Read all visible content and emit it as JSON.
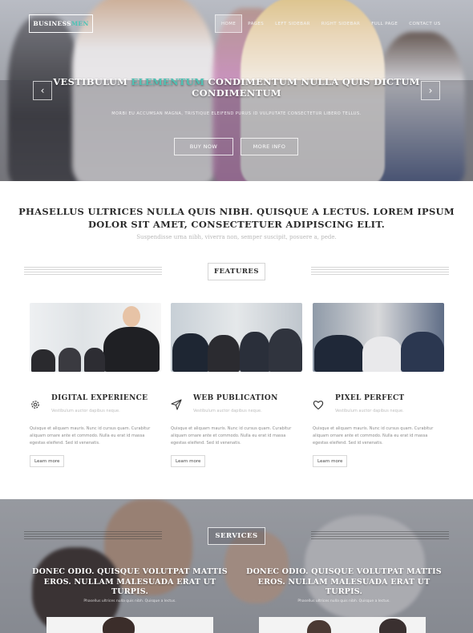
{
  "header": {
    "logo": {
      "text_main": "BUSINESS ",
      "text_accent": "MEN"
    },
    "nav": [
      "HOME",
      "PAGES",
      "LEFT SIDEBAR",
      "RIGHT SIDEBAR",
      "FULL PAGE",
      "CONTACT US"
    ],
    "active_nav": "HOME"
  },
  "hero": {
    "title_pre": "VESTIBULUM ",
    "title_accent": "ELEMENTUM",
    "title_post": " CONDIMENTUM NULLA QUIS DICTUM CONDIMENTUM",
    "subtitle": "MORBI EU ACCUMSAN MAGNA, TRISTIQUE ELEIFEND PURUS ID VULPUTATE CONSECTETUR LIBERO TELLUS.",
    "buttons": {
      "buy": "BUY NOW",
      "more": "MORE INFO"
    },
    "arrow_left": "‹",
    "arrow_right": "›"
  },
  "intro": {
    "title": "PHASELLUS ULTRICES NULLA QUIS NIBH. QUISQUE A LECTUS. LOREM IPSUM DOLOR SIT AMET, CONSECTETUER ADIPISCING ELIT.",
    "subtitle": "Suspendisse urna nibh, viverra non, semper suscipit, posuere a, pede."
  },
  "features": {
    "label": "FEATURES",
    "items": [
      {
        "icon": "gear-icon",
        "title": "DIGITAL EXPERIENCE",
        "subtitle": "Vestibulum auctor dapibus neque.",
        "body": "Quisque et aliquam mauris. Nunc id cursus quam. Curabitur aliquam ornare ante et commodo. Nulla eu erat id massa egestas eleifend. Sed id venenatis.",
        "button": "Learn more"
      },
      {
        "icon": "paper-plane-icon",
        "title": "WEB PUBLICATION",
        "subtitle": "Vestibulum auctor dapibus neque.",
        "body": "Quisque et aliquam mauris. Nunc id cursus quam. Curabitur aliquam ornare ante et commodo. Nulla eu erat id massa egestas eleifend. Sed id venenatis.",
        "button": "Learn more"
      },
      {
        "icon": "heart-icon",
        "title": "PIXEL PERFECT",
        "subtitle": "Vestibulum auctor dapibus neque.",
        "body": "Quisque et aliquam mauris. Nunc id cursus quam. Curabitur aliquam ornare ante et commodo. Nulla eu erat id massa egestas eleifend. Sed id venenatis.",
        "button": "Learn more"
      }
    ]
  },
  "services": {
    "label": "SERVICES",
    "items": [
      {
        "title": "DONEC ODIO. QUISQUE VOLUTPAT MATTIS EROS. NULLAM MALESUADA ERAT UT TURPIS.",
        "subtitle": "Phasellus ultrices nulla quis nibh. Quisque a lectus."
      },
      {
        "title": "DONEC ODIO. QUISQUE VOLUTPAT MATTIS EROS. NULLAM MALESUADA ERAT UT TURPIS.",
        "subtitle": "Phasellus ultrices nulla quis nibh. Quisque a lectus."
      }
    ]
  },
  "colors": {
    "accent": "#4ec3b5",
    "heading": "#2b2b2b",
    "muted": "#b9b9b9"
  }
}
